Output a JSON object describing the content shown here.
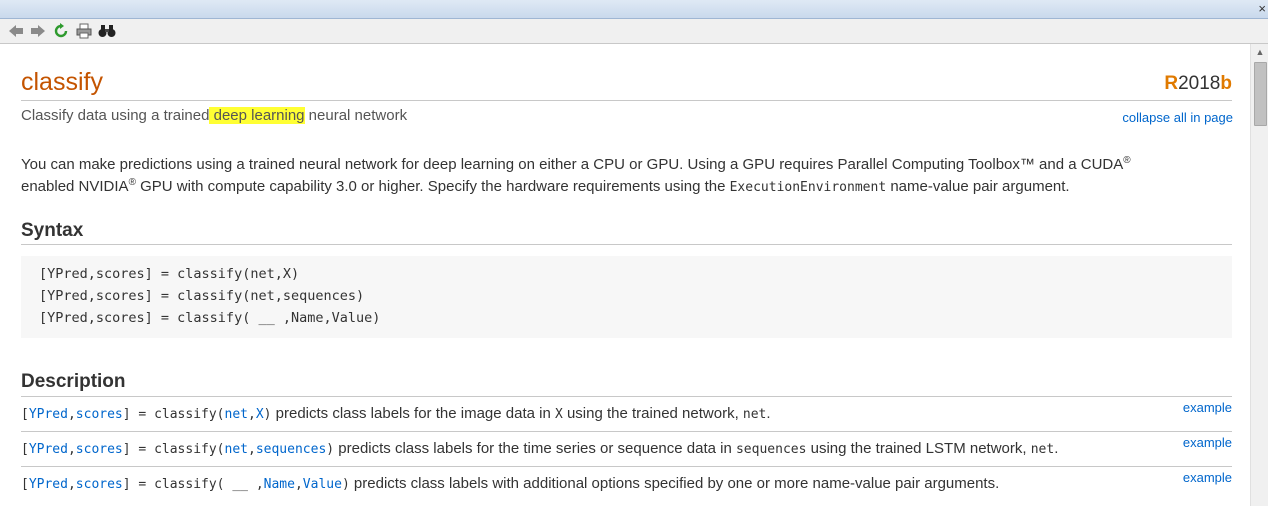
{
  "window": {
    "close_glyph": "×"
  },
  "toolbar": {
    "icons": [
      "back-arrow-icon",
      "forward-arrow-icon",
      "refresh-icon",
      "print-icon",
      "find-binoculars-icon"
    ]
  },
  "page": {
    "title": "classify",
    "release_r": "R",
    "release_year": "2018",
    "release_b": "b",
    "purpose_pre": "Classify data using a trained",
    "purpose_hl": " deep learning",
    "purpose_post": " neural network",
    "collapse": "collapse all in page"
  },
  "intro": {
    "p1": "You can make predictions using a trained neural network for deep learning on either a CPU or GPU. Using a GPU requires Parallel Computing Toolbox™ and a CUDA",
    "reg1": "®",
    "p2": " enabled NVIDIA",
    "reg2": "®",
    "p3": " GPU with compute capability 3.0 or higher. Specify the hardware requirements using the ",
    "code": "ExecutionEnvironment",
    "p4": " name-value pair argument."
  },
  "syntax": {
    "heading": "Syntax",
    "lines": [
      "[YPred,scores] = classify(net,X)",
      "[YPred,scores] = classify(net,sequences)",
      "[YPred,scores] = classify( __ ,Name,Value)"
    ]
  },
  "description": {
    "heading": "Description",
    "rows": [
      {
        "c1": "[",
        "a1": "YPred",
        "c2": ",",
        "a2": "scores",
        "c3": "] = classify(",
        "a3": "net",
        "c4": ",",
        "a4": "X",
        "c5": ")",
        "t1": " predicts class labels for the image data in ",
        "m1": "X",
        "t2": " using the trained network, ",
        "m2": "net",
        "t3": ".",
        "example": "example"
      },
      {
        "c1": "[",
        "a1": "YPred",
        "c2": ",",
        "a2": "scores",
        "c3": "] = classify(",
        "a3": "net",
        "c4": ",",
        "a4": "sequences",
        "c5": ")",
        "t1": " predicts class labels for the time series or sequence data in ",
        "m1": "sequences",
        "t2": " using the trained LSTM network, ",
        "m2": "net",
        "t3": ".",
        "example": "example"
      },
      {
        "c1": "[",
        "a1": "YPred",
        "c2": ",",
        "a2": "scores",
        "c3": "] = classify( __ ,",
        "a3": "Name",
        "c4": ",",
        "a4": "Value",
        "c5": ")",
        "t1": " predicts class labels with additional options specified by one or more name-value pair arguments.",
        "m1": "",
        "t2": "",
        "m2": "",
        "t3": "",
        "example": "example"
      }
    ]
  }
}
